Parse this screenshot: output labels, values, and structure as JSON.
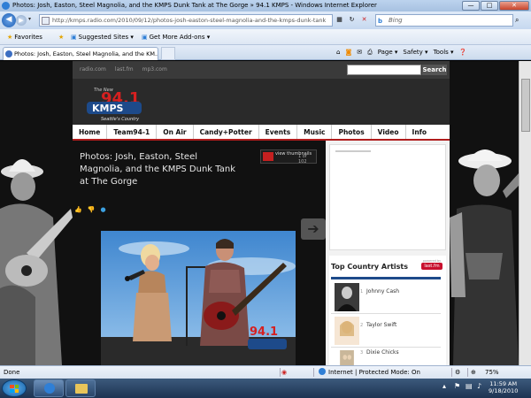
{
  "browser": {
    "window_title": "Photos: Josh, Easton, Steel Magnolia, and the KMPS Dunk Tank at The Gorge » 94.1 KMPS - Windows Internet Explorer",
    "address": "http://kmps.radio.com/2010/09/12/photos-josh-easton-steel-magnolia-and-the-kmps-dunk-tank",
    "search_placeholder": "Bing",
    "favorites_label": "Favorites",
    "suggested_sites_label": "Suggested Sites ▾",
    "addons_label": "Get More Add-ons ▾",
    "tab_title": "Photos: Josh, Easton, Steel Magnolia, and the KM...",
    "cmd_page": "Page ▾",
    "cmd_safety": "Safety ▾",
    "cmd_tools": "Tools ▾",
    "window_buttons": {
      "minimize": "—",
      "maximize": "□",
      "close": "✕"
    }
  },
  "site": {
    "top_links": [
      "radio.com",
      "last.fm",
      "mp3.com"
    ],
    "search_button": "Search",
    "logo_text": "94.1",
    "logo_sub": "KMPS",
    "logo_tagline": "Seattle's Country",
    "logo_new": "The New",
    "menu": [
      "Home",
      "Team94-1",
      "On Air",
      "Candy+Potter",
      "Events",
      "Music",
      "Photos",
      "Video",
      "Info"
    ],
    "page_title": "Photos: Josh, Easton, Steel Magnolia, and the KMPS Dunk Tank at The Gorge",
    "view_thumbnails": "view thumbnails",
    "photo_counter": "1 of 102",
    "photo_watermark": "94.1"
  },
  "sidebar": {
    "heading": "Top Country Artists",
    "powered_by": "powered by",
    "lastfm": "last.fm",
    "artists": [
      {
        "num": "1",
        "name": "Johnny Cash"
      },
      {
        "num": "2",
        "name": "Taylor Swift"
      },
      {
        "num": "3",
        "name": "Dixie Chicks"
      }
    ]
  },
  "statusbar": {
    "status": "Done",
    "zone": "Internet | Protected Mode: On",
    "zoom": "75%"
  },
  "taskbar": {
    "time": "11:59 AM",
    "date": "9/18/2010"
  },
  "colors": {
    "accent_red": "#c42020",
    "menu_underline": "#b01c1c",
    "lastfm_red": "#c8102e",
    "logo_blue": "#1d4a8a"
  }
}
